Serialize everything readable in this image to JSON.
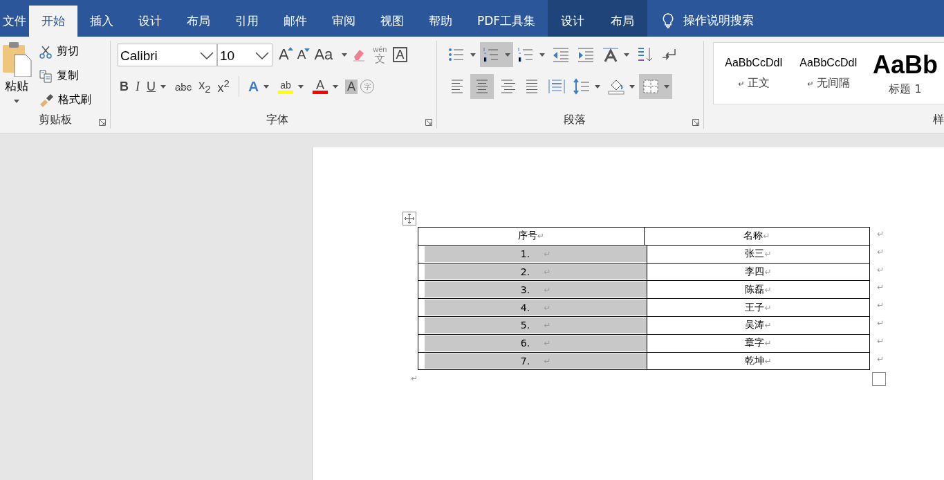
{
  "tabs": [
    {
      "label": "文件",
      "selected": false,
      "contextual": false
    },
    {
      "label": "开始",
      "selected": true,
      "contextual": false
    },
    {
      "label": "插入",
      "selected": false,
      "contextual": false
    },
    {
      "label": "设计",
      "selected": false,
      "contextual": false
    },
    {
      "label": "布局",
      "selected": false,
      "contextual": false
    },
    {
      "label": "引用",
      "selected": false,
      "contextual": false
    },
    {
      "label": "邮件",
      "selected": false,
      "contextual": false
    },
    {
      "label": "审阅",
      "selected": false,
      "contextual": false
    },
    {
      "label": "视图",
      "selected": false,
      "contextual": false
    },
    {
      "label": "帮助",
      "selected": false,
      "contextual": false
    },
    {
      "label": "PDF工具集",
      "selected": false,
      "contextual": false
    },
    {
      "label": "设计",
      "selected": false,
      "contextual": true
    },
    {
      "label": "布局",
      "selected": false,
      "contextual": true
    }
  ],
  "tell_me": {
    "label": "操作说明搜索"
  },
  "clipboard": {
    "title": "剪贴板",
    "paste": "粘贴",
    "items": [
      {
        "kind": "cut",
        "label": "剪切"
      },
      {
        "kind": "copy",
        "label": "复制"
      },
      {
        "kind": "painter",
        "label": "格式刷"
      }
    ]
  },
  "font": {
    "title": "字体",
    "name": "Calibri",
    "size": "10",
    "row1": [
      {
        "kind": "grow",
        "label": "A"
      },
      {
        "kind": "shrink",
        "label": "A"
      },
      {
        "kind": "case",
        "label": "Aa"
      },
      {
        "kind": "clear"
      },
      {
        "kind": "phonetic",
        "label": "wén",
        "sub": "文"
      },
      {
        "kind": "border",
        "label": "A"
      }
    ],
    "row2": [
      {
        "kind": "bold",
        "label": "B"
      },
      {
        "kind": "italic",
        "label": "I"
      },
      {
        "kind": "underline",
        "label": "U",
        "dropdown": true
      },
      {
        "kind": "strike",
        "label": "abc"
      },
      {
        "kind": "plain",
        "label": "x$_{2}$"
      },
      {
        "kind": "plain",
        "label": "x$^{2}$"
      },
      {
        "kind": "effects",
        "label": "A",
        "dropdown": true
      },
      {
        "kind": "highlight",
        "label": "ab",
        "color": "#ffff00",
        "dropdown": true
      },
      {
        "kind": "fontcolor",
        "label": "A",
        "color": "#ff0000",
        "dropdown": true
      },
      {
        "kind": "shade",
        "label": "A"
      },
      {
        "kind": "enclose",
        "label": "字"
      }
    ]
  },
  "paragraph": {
    "title": "段落",
    "row1": [
      {
        "kind": "bullets",
        "dropdown": true,
        "selected": false
      },
      {
        "kind": "numbering",
        "dropdown": true,
        "selected": true
      },
      {
        "kind": "multilevel",
        "dropdown": true,
        "selected": false
      },
      {
        "kind": "outdent",
        "dropdown": false,
        "selected": false
      },
      {
        "kind": "indent",
        "dropdown": false,
        "selected": false
      },
      {
        "kind": "direction",
        "dropdown": true,
        "selected": false
      },
      {
        "kind": "sort",
        "dropdown": false,
        "selected": false
      },
      {
        "kind": "marks",
        "dropdown": false,
        "selected": false
      }
    ],
    "row2": [
      {
        "kind": "left",
        "dropdown": false,
        "selected": false
      },
      {
        "kind": "center",
        "dropdown": false,
        "selected": true
      },
      {
        "kind": "right",
        "dropdown": false,
        "selected": false
      },
      {
        "kind": "justify",
        "dropdown": false,
        "selected": false
      },
      {
        "kind": "distribute",
        "dropdown": false,
        "selected": false
      },
      {
        "kind": "spacing",
        "dropdown": true,
        "selected": false
      },
      {
        "kind": "fill",
        "dropdown": true,
        "selected": false
      },
      {
        "kind": "borders",
        "dropdown": true,
        "selected": true
      }
    ]
  },
  "styles": {
    "title": "样",
    "items": [
      {
        "kind": "normal",
        "preview": "AaBbCcDdI",
        "name": "正文",
        "mark": "↵"
      },
      {
        "kind": "normal",
        "preview": "AaBbCcDdI",
        "name": "无间隔",
        "mark": "↵"
      },
      {
        "kind": "heading",
        "preview": "AaBb",
        "name": "标题 1"
      }
    ]
  },
  "table": {
    "header": [
      "序号",
      "名称"
    ],
    "header_marks": [
      "↵",
      "↵",
      "↵"
    ],
    "rows": [
      {
        "number": "1.",
        "name": "张三",
        "selected": true,
        "marks": [
          "↵",
          "↵",
          "↵"
        ]
      },
      {
        "number": "2.",
        "name": "李四",
        "selected": true,
        "marks": [
          "↵",
          "↵",
          "↵"
        ]
      },
      {
        "number": "3.",
        "name": "陈磊",
        "selected": true,
        "marks": [
          "↵",
          "↵",
          "↵"
        ]
      },
      {
        "number": "4.",
        "name": "王子",
        "selected": true,
        "marks": [
          "↵",
          "↵",
          "↵"
        ]
      },
      {
        "number": "5.",
        "name": "吴涛",
        "selected": true,
        "marks": [
          "↵",
          "↵",
          "↵"
        ]
      },
      {
        "number": "6.",
        "name": "章字",
        "selected": true,
        "marks": [
          "↵",
          "↵",
          "↵"
        ]
      },
      {
        "number": "7.",
        "name": "乾坤",
        "selected": true,
        "marks": [
          "↵",
          "↵",
          "↵"
        ]
      }
    ],
    "after_mark": "↵"
  }
}
